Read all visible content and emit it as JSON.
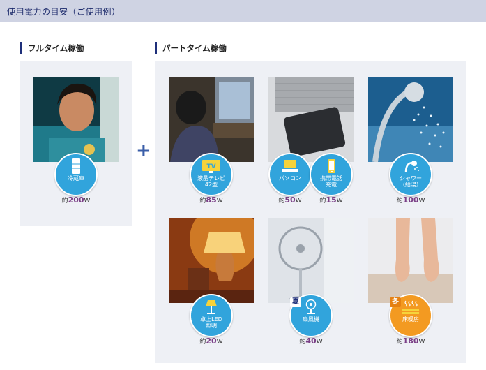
{
  "header": {
    "title": "使用電力の目安（ご使用例）"
  },
  "sections": {
    "full": {
      "title": "フルタイム稼働"
    },
    "part": {
      "title": "パートタイム稼働"
    }
  },
  "plus": "+",
  "appliances": {
    "fridge": {
      "label": "冷蔵庫",
      "prefix": "約",
      "value": "200",
      "unit": "W",
      "icon": "refrigerator-icon"
    },
    "tv": {
      "label": "液晶テレビ\n42型",
      "prefix": "約",
      "value": "85",
      "unit": "W",
      "icon": "tv-icon",
      "icon_text": "TV"
    },
    "pc": {
      "label": "パソコン",
      "prefix": "約",
      "value": "50",
      "unit": "W",
      "icon": "laptop-icon"
    },
    "phone": {
      "label": "携帯電話\n充電",
      "prefix": "約",
      "value": "15",
      "unit": "W",
      "icon": "phone-charging-icon"
    },
    "shower": {
      "label": "シャワー\n（給湯）",
      "prefix": "約",
      "value": "100",
      "unit": "W",
      "icon": "shower-icon"
    },
    "lamp": {
      "label": "卓上LED\n照明",
      "prefix": "約",
      "value": "20",
      "unit": "W",
      "icon": "desk-lamp-icon"
    },
    "fan": {
      "label": "扇風機",
      "prefix": "約",
      "value": "40",
      "unit": "W",
      "icon": "fan-icon",
      "season": "夏"
    },
    "floorheat": {
      "label": "床暖房",
      "prefix": "約",
      "value": "180",
      "unit": "W",
      "icon": "floor-heating-icon",
      "season": "冬"
    }
  },
  "colors": {
    "header_bg": "#cfd3e3",
    "accent": "#1e2f7a",
    "circle_blue": "#31a4dc",
    "circle_orange": "#f39a21",
    "watt_value": "#7a3f86"
  }
}
